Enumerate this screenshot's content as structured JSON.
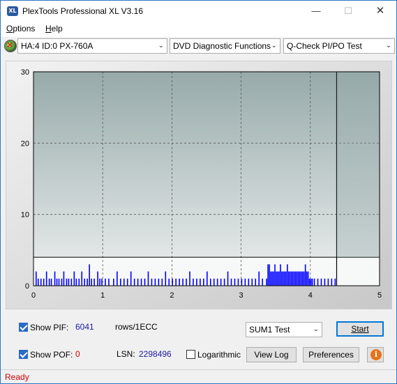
{
  "window": {
    "title": "PlexTools Professional XL V3.16",
    "icon_text": "XL",
    "minimize": "—",
    "maximize": "☐",
    "close": "✕"
  },
  "menu": {
    "options": {
      "underlined": "O",
      "rest": "ptions"
    },
    "help": {
      "underlined": "H",
      "rest": "elp"
    }
  },
  "toolbar": {
    "drive": "HA:4 ID:0  PX-760A",
    "function": "DVD Diagnostic Functions",
    "test": "Q-Check PI/PO Test",
    "arrow": "⌄"
  },
  "chart_data": {
    "type": "bar",
    "xlim": [
      0,
      5
    ],
    "ylim": [
      0,
      30
    ],
    "xticks": [
      "0",
      "1",
      "2",
      "3",
      "4",
      "5"
    ],
    "yticks": [
      "0",
      "10",
      "20",
      "30"
    ],
    "grid": true,
    "threshold_line_y": 4,
    "end_marker_x": 4.38,
    "series": [
      {
        "color": "#0000ff",
        "x": [
          0.03,
          0.06,
          0.1,
          0.14,
          0.18,
          0.22,
          0.25,
          0.3,
          0.33,
          0.36,
          0.4,
          0.43,
          0.47,
          0.5,
          0.54,
          0.58,
          0.61,
          0.65,
          0.69,
          0.73,
          0.77,
          0.8,
          0.83,
          0.87,
          0.92,
          0.95,
          0.98,
          1.03,
          1.08,
          1.15,
          1.2,
          1.25,
          1.3,
          1.35,
          1.4,
          1.45,
          1.5,
          1.55,
          1.6,
          1.65,
          1.7,
          1.75,
          1.8,
          1.85,
          1.9,
          1.95,
          2.0,
          2.05,
          2.1,
          2.15,
          2.2,
          2.25,
          2.3,
          2.35,
          2.4,
          2.45,
          2.5,
          2.55,
          2.6,
          2.65,
          2.7,
          2.75,
          2.8,
          2.85,
          2.9,
          2.95,
          3.0,
          3.05,
          3.1,
          3.15,
          3.2,
          3.25,
          3.3,
          3.36,
          3.38,
          3.4,
          3.42,
          3.44,
          3.46,
          3.48,
          3.5,
          3.52,
          3.54,
          3.56,
          3.58,
          3.6,
          3.62,
          3.64,
          3.66,
          3.68,
          3.7,
          3.72,
          3.74,
          3.76,
          3.78,
          3.8,
          3.82,
          3.84,
          3.86,
          3.88,
          3.9,
          3.92,
          3.94,
          3.96,
          3.98,
          4.0,
          4.02,
          4.05,
          4.1,
          4.15,
          4.2,
          4.25,
          4.3,
          4.35
        ],
        "values": [
          2,
          1,
          1,
          1,
          2,
          1,
          1,
          2,
          1,
          1,
          1,
          2,
          1,
          1,
          1,
          2,
          1,
          1,
          2,
          1,
          1,
          3,
          1,
          1,
          2,
          1,
          1,
          1,
          1,
          1,
          2,
          1,
          1,
          1,
          2,
          1,
          1,
          1,
          1,
          2,
          1,
          1,
          1,
          1,
          2,
          1,
          1,
          1,
          1,
          1,
          1,
          2,
          1,
          1,
          1,
          1,
          2,
          1,
          1,
          1,
          1,
          1,
          2,
          1,
          1,
          1,
          1,
          1,
          1,
          1,
          1,
          2,
          1,
          1,
          3,
          3,
          2,
          2,
          2,
          3,
          2,
          2,
          2,
          3,
          2,
          2,
          2,
          2,
          3,
          2,
          2,
          2,
          2,
          2,
          2,
          2,
          2,
          2,
          2,
          2,
          2,
          3,
          2,
          2,
          1,
          1,
          1,
          1,
          1,
          1,
          1,
          1,
          1,
          1
        ]
      }
    ]
  },
  "controls": {
    "show_pif_label": "Show PIF:",
    "pif_value": "6041",
    "pif_unit": "rows/1ECC",
    "show_pof_label": "Show POF:",
    "pof_value": "0",
    "lsn_label": "LSN:",
    "lsn_value": "2298496",
    "logarithmic_label": "Logarithmic",
    "sum_select": "SUM1 Test",
    "start_button": "Start",
    "view_log_button": "View Log",
    "preferences_button": "Preferences",
    "info_button": "i"
  },
  "status": {
    "text": "Ready"
  }
}
